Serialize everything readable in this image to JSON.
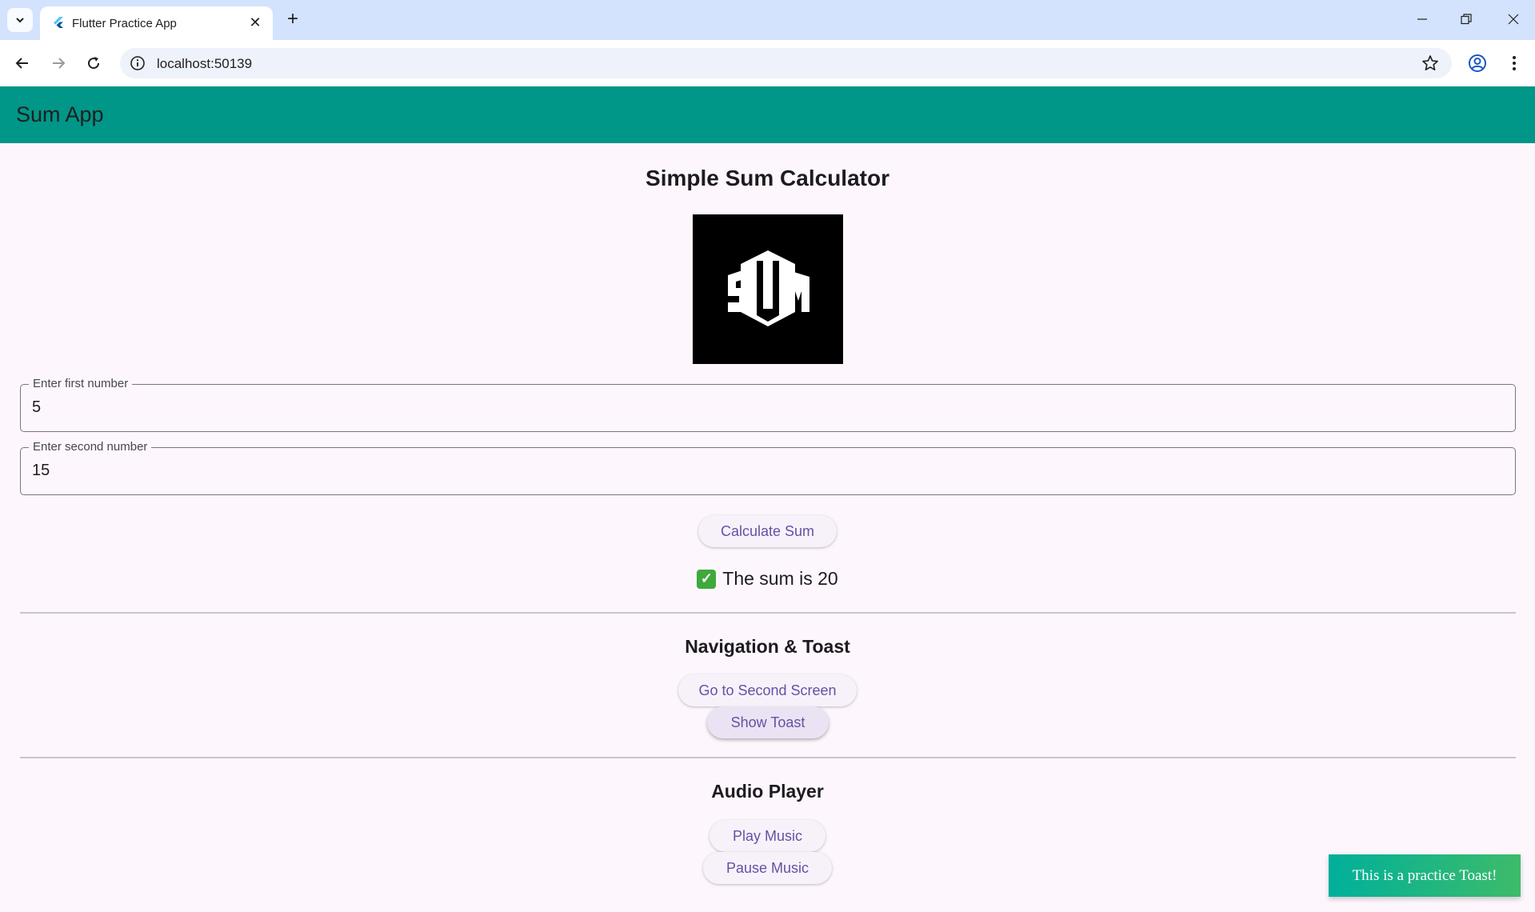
{
  "browser": {
    "tab_title": "Flutter Practice App",
    "url": "localhost:50139"
  },
  "app": {
    "title": "Sum App",
    "calculator": {
      "heading": "Simple Sum Calculator",
      "logo_text": "SUM",
      "first_field": {
        "label": "Enter first number",
        "value": "5"
      },
      "second_field": {
        "label": "Enter second number",
        "value": "15"
      },
      "calculate_label": "Calculate Sum",
      "result_text": "The sum is 20"
    },
    "navigation": {
      "heading": "Navigation & Toast",
      "second_screen_label": "Go to Second Screen",
      "show_toast_label": "Show Toast"
    },
    "audio": {
      "heading": "Audio Player",
      "play_label": "Play Music",
      "pause_label": "Pause Music"
    },
    "toast": {
      "message": "This is a practice Toast!"
    }
  },
  "colors": {
    "appbar": "#009688",
    "button_text": "#6750a4",
    "toast_start": "#00b09b",
    "toast_end": "#3dbb6a"
  },
  "icons": {
    "tab_search": "chevron-down-icon",
    "favicon": "flutter-icon",
    "close": "close-icon",
    "new_tab": "plus-icon",
    "back": "back-arrow-icon",
    "forward": "forward-arrow-icon",
    "reload": "reload-icon",
    "info": "info-icon",
    "bookmark": "star-icon",
    "profile": "profile-icon",
    "menu": "kebab-menu-icon",
    "result": "check-mark-icon"
  }
}
